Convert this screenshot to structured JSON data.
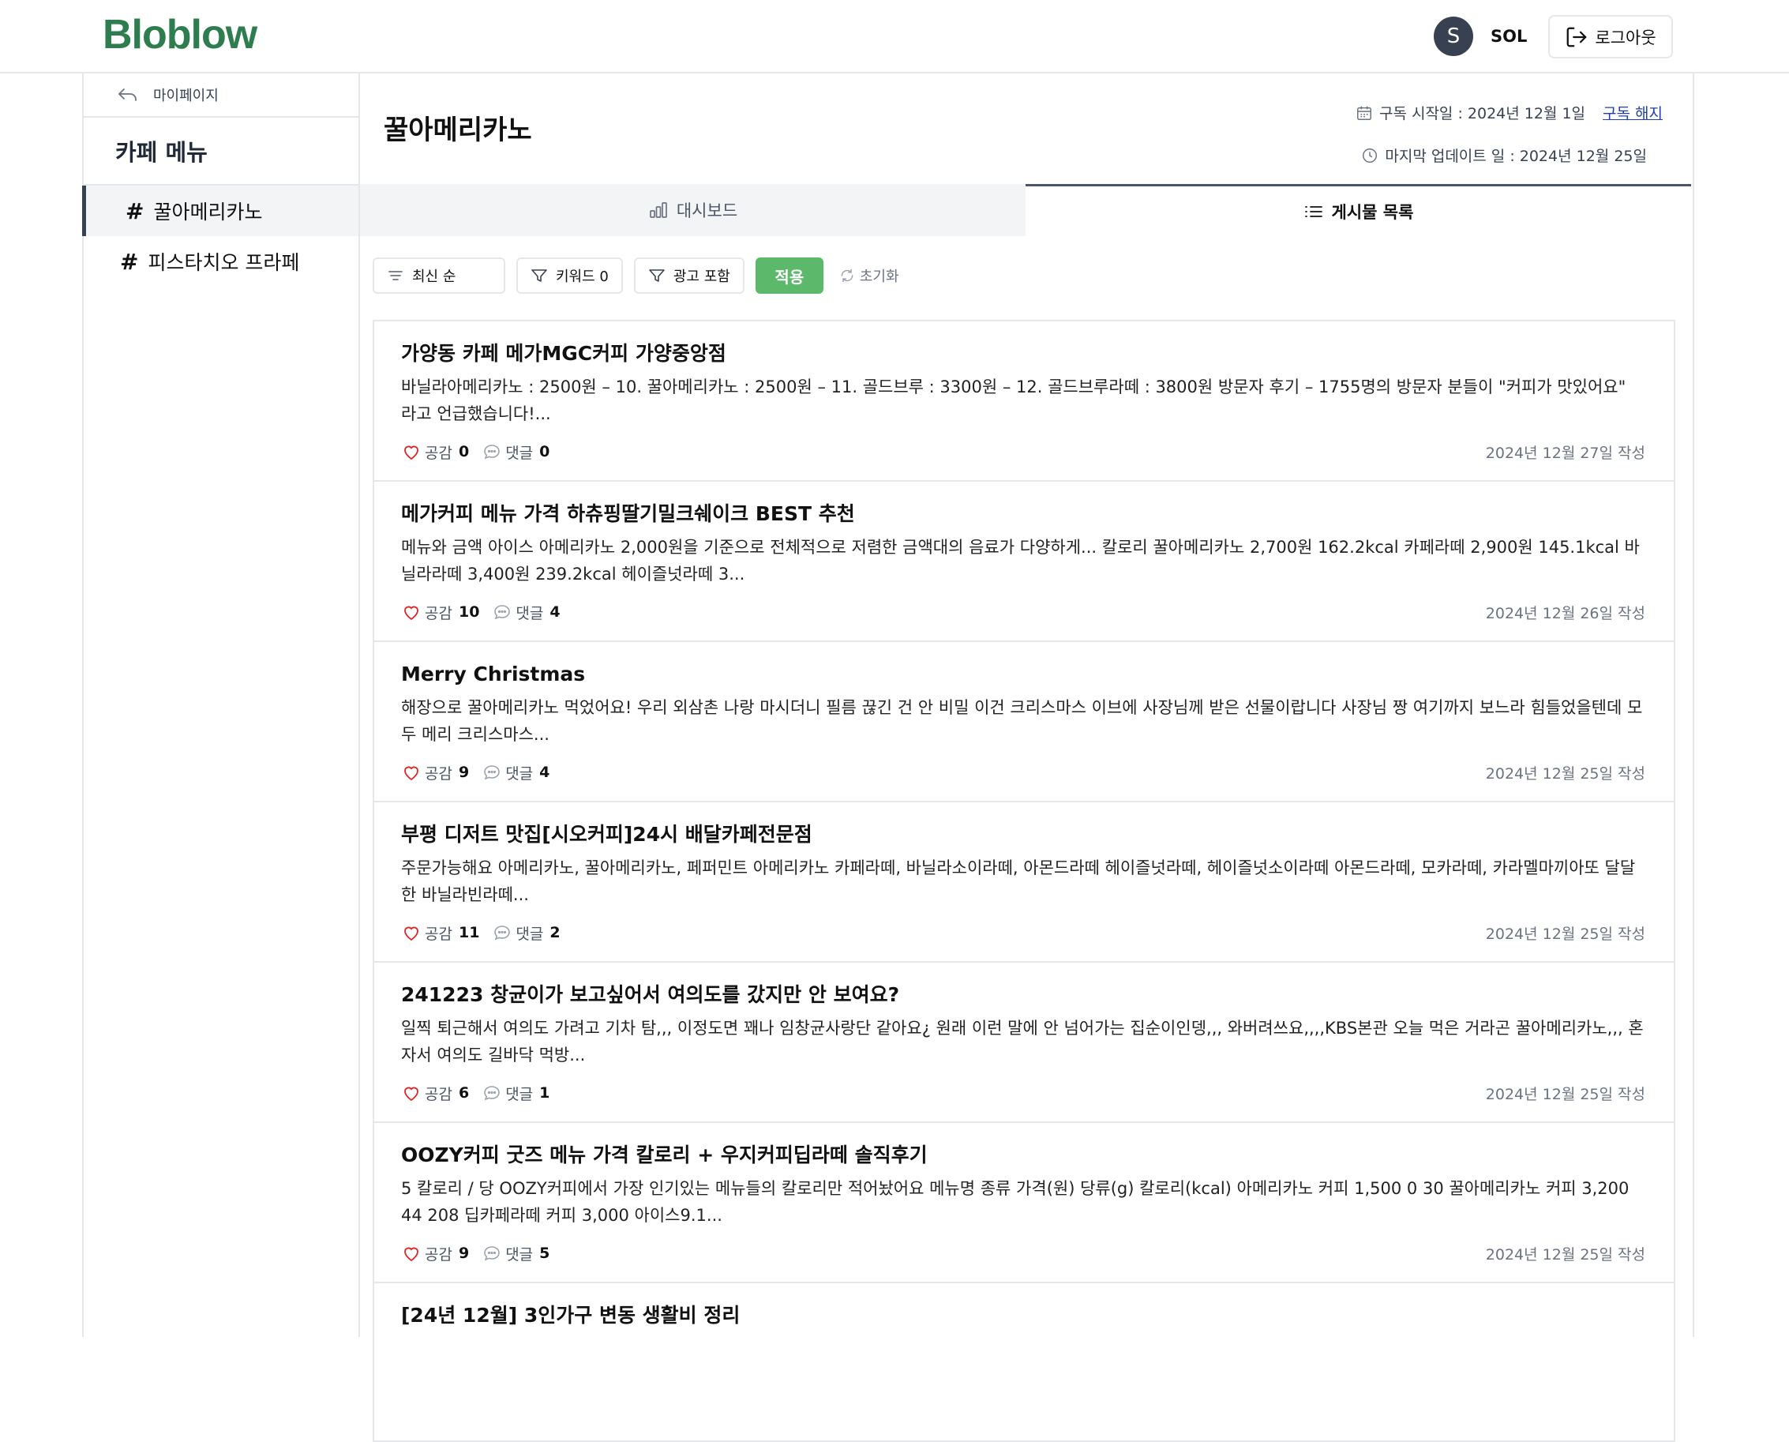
{
  "header": {
    "logo": "Bloblow",
    "user_initial": "S",
    "user_name": "SOL",
    "logout_label": "로그아웃"
  },
  "sidebar": {
    "back_label": "마이페이지",
    "title": "카페 메뉴",
    "items": [
      {
        "hash": "#",
        "label": "꿀아메리카노",
        "active": true
      },
      {
        "hash": "#",
        "label": "피스타치오 프라페",
        "active": false
      }
    ]
  },
  "main": {
    "title": "꿀아메리카노",
    "subscribe_start": "구독 시작일 : 2024년 12월 1일",
    "unsubscribe_label": "구독 해지",
    "last_update": "마지막 업데이트 일 : 2024년 12월 25일",
    "tabs": [
      {
        "label": "대시보드",
        "active": false
      },
      {
        "label": "게시물 목록",
        "active": true
      }
    ],
    "filters": {
      "sort_label": "최신 순",
      "keyword_label": "키워드 0",
      "ad_label": "광고 포함",
      "apply_label": "적용",
      "reset_label": "초기화"
    },
    "posts": [
      {
        "title": "가양동 카페 메가MGC커피 가양중앙점",
        "body": "바닐라아메리카노 : 2500원 – 10. 꿀아메리카노 : 2500원 – 11. 골드브루 : 3300원 – 12. 골드브루라떼 : 3800원 방문자 후기 – 1755명의 방문자 분들이 \"커피가 맛있어요\" 라고 언급했습니다!...",
        "like_label": "공감",
        "likes": "0",
        "comment_label": "댓글",
        "comments": "0",
        "date": "2024년 12월 27일 작성"
      },
      {
        "title": "메가커피 메뉴 가격 하츄핑딸기밀크쉐이크 BEST 추천",
        "body": "메뉴와 금액 아이스 아메리카노 2,000원을 기준으로 전체적으로 저렴한 금액대의 음료가 다양하게... 칼로리 꿀아메리카노 2,700원 162.2kcal 카페라떼 2,900원 145.1kcal 바닐라라떼 3,400원 239.2kcal 헤이즐넛라떼 3...",
        "like_label": "공감",
        "likes": "10",
        "comment_label": "댓글",
        "comments": "4",
        "date": "2024년 12월 26일 작성"
      },
      {
        "title": "Merry Christmas",
        "body": "해장으로 꿀아메리카노 먹었어요! 우리 외삼촌 나랑 마시더니 필름 끊긴 건 안 비밀 이건 크리스마스 이브에 사장님께 받은 선물이랍니다 사장님 짱 여기까지 보느라 힘들었을텐데 모두 메리 크리스마스...",
        "like_label": "공감",
        "likes": "9",
        "comment_label": "댓글",
        "comments": "4",
        "date": "2024년 12월 25일 작성"
      },
      {
        "title": "부평 디저트 맛집[시오커피]24시 배달카페전문점",
        "body": "주문가능해요 아메리카노, 꿀아메리카노, 페퍼민트 아메리카노 카페라떼, 바닐라소이라떼, 아몬드라떼 헤이즐넛라떼, 헤이즐넛소이라떼 아몬드라떼, 모카라떼, 카라멜마끼아또 달달한 바닐라빈라떼...",
        "like_label": "공감",
        "likes": "11",
        "comment_label": "댓글",
        "comments": "2",
        "date": "2024년 12월 25일 작성"
      },
      {
        "title": "241223 창균이가 보고싶어서 여의도를 갔지만 안 보여요?",
        "body": "일찍 퇴근해서 여의도 가려고 기차 탐,,, 이정도면 꽤나 임창균사랑단 같아요¿ 원래 이런 말에 안 넘어가는 집순이인뎅,,, 와버려쓰요,,,,KBS본관 오늘 먹은 거라곤 꿀아메리카노,,, 혼자서 여의도 길바닥 먹방...",
        "like_label": "공감",
        "likes": "6",
        "comment_label": "댓글",
        "comments": "1",
        "date": "2024년 12월 25일 작성"
      },
      {
        "title": "OOZY커피 굿즈 메뉴 가격 칼로리 + 우지커피딥라떼 솔직후기",
        "body": "5 칼로리 / 당 OOZY커피에서 가장 인기있는 메뉴들의 칼로리만 적어놨어요 메뉴명 종류 가격(원) 당류(g) 칼로리(kcal) 아메리카노 커피 1,500 0 30 꿀아메리카노 커피 3,200 44 208 딥카페라떼 커피 3,000 아이스9.1...",
        "like_label": "공감",
        "likes": "9",
        "comment_label": "댓글",
        "comments": "5",
        "date": "2024년 12월 25일 작성"
      },
      {
        "title": "[24년 12월] 3인가구 변동 생활비 정리",
        "body": "",
        "like_label": "",
        "likes": "",
        "comment_label": "",
        "comments": "",
        "date": ""
      }
    ]
  },
  "colors": {
    "brand": "#2e7d4f",
    "apply": "#5cb96b",
    "link": "#1e40af",
    "heart": "#dc2626"
  },
  "icons": [
    "logout-icon",
    "back-arrow-icon",
    "calendar-icon",
    "clock-icon",
    "bar-chart-icon",
    "list-icon",
    "sort-icon",
    "filter-icon",
    "refresh-icon",
    "heart-icon",
    "comment-icon"
  ]
}
